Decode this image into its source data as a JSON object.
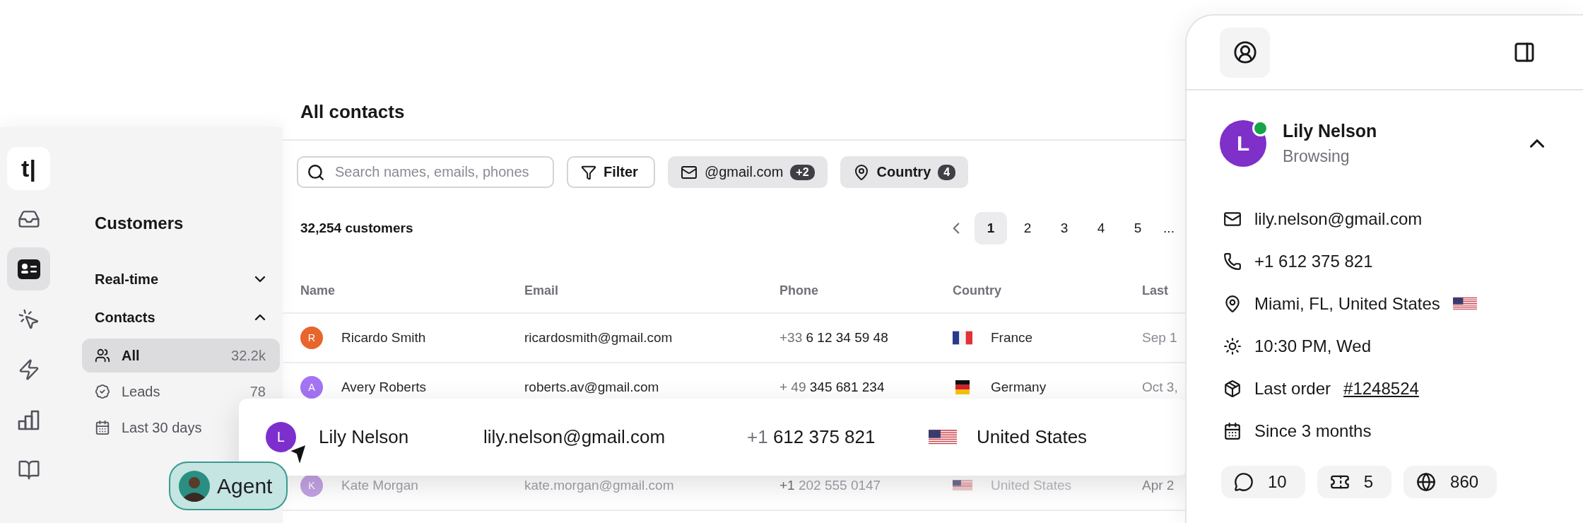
{
  "nav_rail": {
    "logo": "t|",
    "items": [
      {
        "kind": "inbox",
        "selected": false
      },
      {
        "kind": "contacts",
        "selected": true
      },
      {
        "kind": "click",
        "selected": false
      },
      {
        "kind": "automation",
        "selected": false
      },
      {
        "kind": "reports",
        "selected": false
      },
      {
        "kind": "docs",
        "selected": false
      }
    ]
  },
  "sidebar": {
    "title": "Customers",
    "sections": [
      {
        "label": "Real-time",
        "expanded": false
      },
      {
        "label": "Contacts",
        "expanded": true,
        "children": [
          {
            "kind": "all",
            "label": "All",
            "count": "32.2k",
            "selected": true
          },
          {
            "kind": "leads",
            "label": "Leads",
            "count": "78",
            "selected": false
          },
          {
            "kind": "recent",
            "label": "Last 30 days",
            "selected": false
          }
        ]
      }
    ]
  },
  "main": {
    "title": "All contacts",
    "search": {
      "placeholder": "Search names, emails, phones"
    },
    "filter_button": "Filter",
    "chips": [
      {
        "kind": "email",
        "label": "@gmail.com",
        "count": "+2",
        "bold": false
      },
      {
        "kind": "location",
        "label": "Country",
        "count": "4",
        "bold": true
      }
    ],
    "total": "32,254 customers",
    "pagination": {
      "pages": [
        {
          "label": "1",
          "selected": true
        },
        {
          "label": "2",
          "selected": false
        },
        {
          "label": "3",
          "selected": false
        },
        {
          "label": "4",
          "selected": false
        },
        {
          "label": "5",
          "selected": false
        }
      ],
      "ellipsis": "..."
    },
    "table": {
      "columns": [
        "Name",
        "Email",
        "Phone",
        "Country",
        "Last"
      ],
      "rows": [
        {
          "kind": "row",
          "initial": "R",
          "color": "#e8652b",
          "name": "Ricardo Smith",
          "email": "ricardosmith@gmail.com",
          "phone_prefix": "+33",
          "phone": "6 12 34 59 48",
          "flag": {
            "kind": "fr"
          },
          "country": "France",
          "last": "Sep 1",
          "faded": false
        },
        {
          "kind": "row",
          "initial": "A",
          "color": "#a474f4",
          "name": "Avery Roberts",
          "email": "roberts.av@gmail.com",
          "phone_prefix": "+ 49",
          "phone": "345 681 234",
          "flag": {
            "kind": "de"
          },
          "country": "Germany",
          "last": "Oct 3,",
          "faded": false
        },
        {
          "kind": "lifted",
          "initial": "L",
          "color": "#7d2fce",
          "name": "Lily Nelson",
          "email": "lily.nelson@gmail.com",
          "phone_prefix": "+1",
          "phone": "612 375 821",
          "flag": {
            "kind": "us"
          },
          "country": "United States",
          "faded": false
        },
        {
          "kind": "row",
          "initial": "K",
          "color": "#c3a2e4",
          "name": "Kate Morgan",
          "email": "kate.morgan@gmail.com",
          "phone_prefix": "+1",
          "phone": "202 555 0147",
          "flag": {
            "kind": "us"
          },
          "country": "United States",
          "last": "Apr 2",
          "faded": true
        }
      ]
    }
  },
  "agent": {
    "label": "Agent"
  },
  "contact_panel": {
    "profile": {
      "initial": "L",
      "color": "#7e30c9",
      "name": "Lily Nelson",
      "status": "Browsing",
      "online": true,
      "expanded": true
    },
    "details": [
      {
        "kind": "email",
        "text": "lily.nelson@gmail.com"
      },
      {
        "kind": "phone",
        "text": "+1 612 375 821"
      },
      {
        "kind": "location",
        "text": "Miami, FL, United States",
        "flag": {
          "kind": "us"
        }
      },
      {
        "kind": "time",
        "text": "10:30 PM, Wed"
      },
      {
        "kind": "order",
        "text": "Last order",
        "link": "#1248524"
      },
      {
        "kind": "since",
        "text": "Since 3 months"
      }
    ],
    "stats": [
      {
        "kind": "conversations",
        "value": "10"
      },
      {
        "kind": "tickets",
        "value": "5"
      },
      {
        "kind": "visits",
        "value": "860"
      }
    ]
  }
}
